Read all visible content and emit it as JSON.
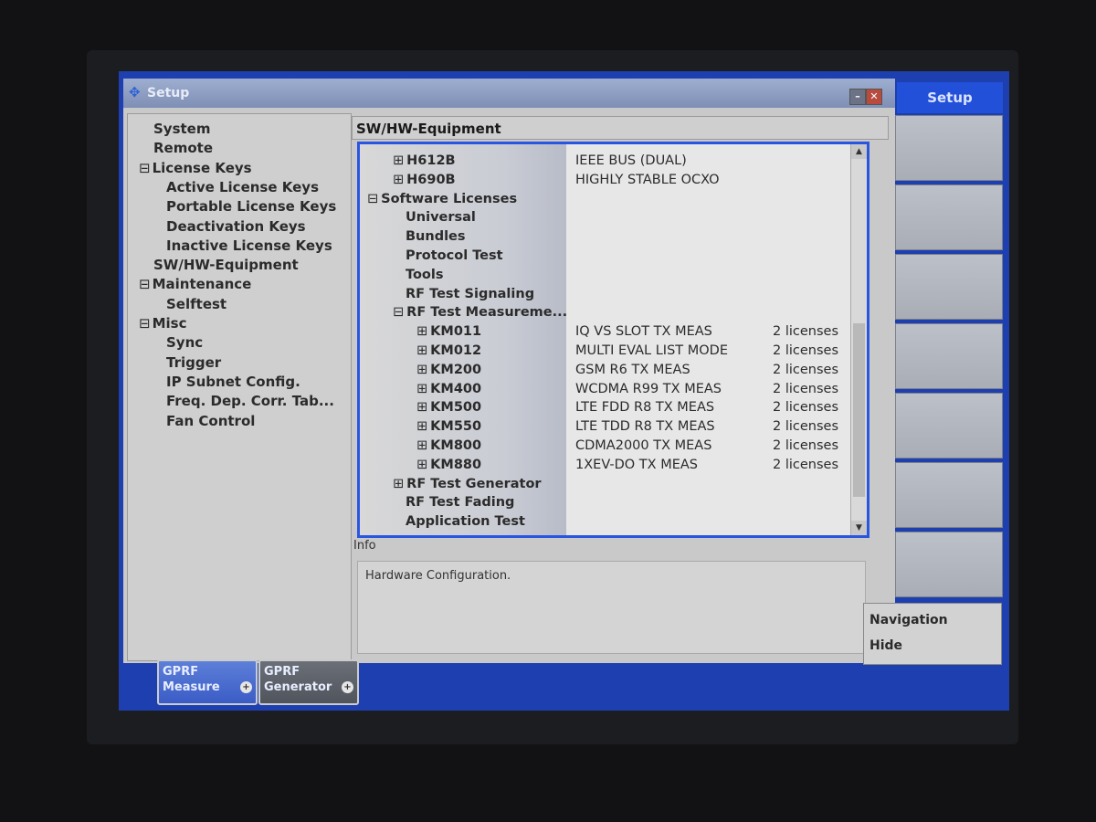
{
  "window": {
    "title": "Setup"
  },
  "nav_tree": [
    {
      "label": "System",
      "prefix": "",
      "indent": 0
    },
    {
      "label": "Remote",
      "prefix": "",
      "indent": 0
    },
    {
      "label": "License Keys",
      "prefix": "⊟",
      "indent": 0
    },
    {
      "label": "Active License Keys",
      "prefix": "",
      "indent": 1
    },
    {
      "label": "Portable License Keys",
      "prefix": "",
      "indent": 1
    },
    {
      "label": "Deactivation Keys",
      "prefix": "",
      "indent": 1
    },
    {
      "label": "Inactive License Keys",
      "prefix": "",
      "indent": 1
    },
    {
      "label": "SW/HW-Equipment",
      "prefix": "",
      "indent": 0
    },
    {
      "label": "Maintenance",
      "prefix": "⊟",
      "indent": 0
    },
    {
      "label": "Selftest",
      "prefix": "",
      "indent": 1
    },
    {
      "label": "Misc",
      "prefix": "⊟",
      "indent": 0
    },
    {
      "label": "Sync",
      "prefix": "",
      "indent": 1
    },
    {
      "label": "Trigger",
      "prefix": "",
      "indent": 1
    },
    {
      "label": "IP Subnet Config.",
      "prefix": "",
      "indent": 1
    },
    {
      "label": "Freq. Dep. Corr. Tab...",
      "prefix": "",
      "indent": 1
    },
    {
      "label": "Fan Control",
      "prefix": "",
      "indent": 1
    }
  ],
  "section_title": "SW/HW-Equipment",
  "equipment_rows": [
    {
      "name": "H612B",
      "prefix": "⊞",
      "level": 1,
      "desc": "IEEE BUS (DUAL)",
      "licenses": ""
    },
    {
      "name": "H690B",
      "prefix": "⊞",
      "level": 1,
      "desc": "HIGHLY STABLE OCXO",
      "licenses": ""
    },
    {
      "name": "Software Licenses",
      "prefix": "⊟",
      "level": 0,
      "desc": "",
      "licenses": ""
    },
    {
      "name": "Universal",
      "prefix": "",
      "level": 1,
      "desc": "",
      "licenses": ""
    },
    {
      "name": "Bundles",
      "prefix": "",
      "level": 1,
      "desc": "",
      "licenses": ""
    },
    {
      "name": "Protocol Test",
      "prefix": "",
      "level": 1,
      "desc": "",
      "licenses": ""
    },
    {
      "name": "Tools",
      "prefix": "",
      "level": 1,
      "desc": "",
      "licenses": ""
    },
    {
      "name": "RF Test Signaling",
      "prefix": "",
      "level": 1,
      "desc": "",
      "licenses": ""
    },
    {
      "name": "RF Test Measureme...",
      "prefix": "⊟",
      "level": 1,
      "desc": "",
      "licenses": ""
    },
    {
      "name": "KM011",
      "prefix": "⊞",
      "level": 2,
      "desc": "IQ VS SLOT TX MEAS",
      "licenses": "2 licenses"
    },
    {
      "name": "KM012",
      "prefix": "⊞",
      "level": 2,
      "desc": "MULTI EVAL LIST MODE",
      "licenses": "2 licenses"
    },
    {
      "name": "KM200",
      "prefix": "⊞",
      "level": 2,
      "desc": "GSM R6 TX MEAS",
      "licenses": "2 licenses"
    },
    {
      "name": "KM400",
      "prefix": "⊞",
      "level": 2,
      "desc": "WCDMA R99 TX MEAS",
      "licenses": "2 licenses"
    },
    {
      "name": "KM500",
      "prefix": "⊞",
      "level": 2,
      "desc": "LTE FDD R8 TX MEAS",
      "licenses": "2 licenses"
    },
    {
      "name": "KM550",
      "prefix": "⊞",
      "level": 2,
      "desc": "LTE TDD R8 TX MEAS",
      "licenses": "2 licenses"
    },
    {
      "name": "KM800",
      "prefix": "⊞",
      "level": 2,
      "desc": "CDMA2000 TX MEAS",
      "licenses": "2 licenses"
    },
    {
      "name": "KM880",
      "prefix": "⊞",
      "level": 2,
      "desc": "1XEV-DO TX MEAS",
      "licenses": "2 licenses"
    },
    {
      "name": "RF Test Generator",
      "prefix": "⊞",
      "level": 1,
      "desc": "",
      "licenses": ""
    },
    {
      "name": "RF Test Fading",
      "prefix": "",
      "level": 1,
      "desc": "",
      "licenses": ""
    },
    {
      "name": "Application Test",
      "prefix": "",
      "level": 1,
      "desc": "",
      "licenses": ""
    }
  ],
  "info": {
    "label": "Info",
    "text": "Hardware Configuration."
  },
  "softkeys": {
    "title": "Setup",
    "nav_line1": "Navigation",
    "nav_line2": "Hide"
  },
  "tasks": [
    {
      "line1": "GPRF",
      "line2": "Measure",
      "icon": "+"
    },
    {
      "line1": "GPRF",
      "line2": "Generator",
      "icon": "+"
    }
  ],
  "colors": {
    "screen_background": "#1d3fb0",
    "selection_border": "#2a55e0",
    "softkey_title": "#2250d8"
  }
}
